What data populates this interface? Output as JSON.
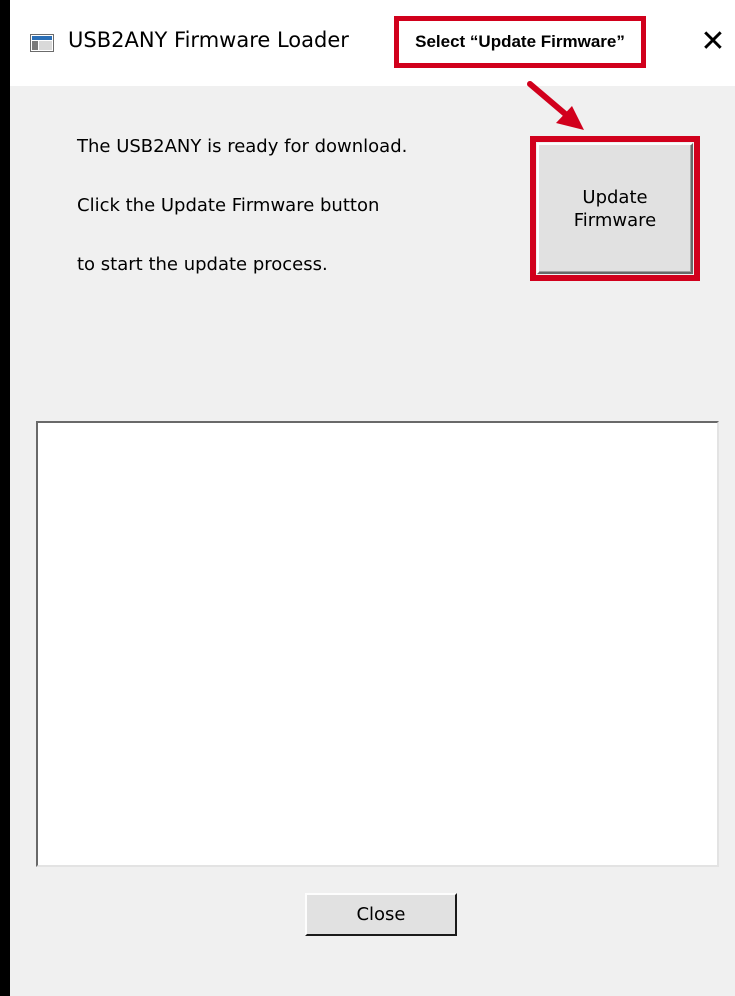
{
  "window": {
    "title": "USB2ANY Firmware Loader",
    "close_glyph": "✕",
    "icon": "window-app-icon"
  },
  "annotation": {
    "callout_text": "Select “Update Firmware”",
    "color": "#d1001c"
  },
  "messages": [
    "The USB2ANY is ready for download.",
    "Click the Update Firmware button",
    "to start the update process."
  ],
  "update_button": {
    "line1": "Update",
    "line2": "Firmware"
  },
  "log": {
    "content": ""
  },
  "close_button": {
    "label": "Close"
  }
}
